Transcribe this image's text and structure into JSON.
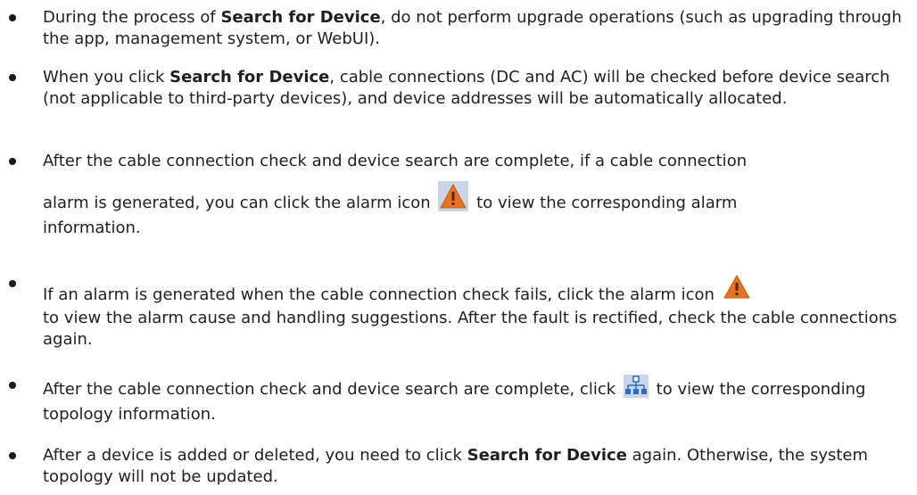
{
  "items": [
    {
      "pre": "During the process of ",
      "bold": "Search for Device",
      "post": ", do not perform upgrade operations (such as upgrading through the app, management system, or WebUI)."
    },
    {
      "pre": "When you click ",
      "bold": "Search for Device",
      "post": ", cable connections (DC and AC) will be checked before device search (not applicable to third-party devices), and device addresses will be automatically allocated."
    },
    {
      "line1": "After the cable connection check and device search are complete, if a cable connection",
      "line2_pre": "alarm is generated, you can click the alarm icon",
      "line2_post": "to view the corresponding alarm",
      "line3": "information."
    },
    {
      "pre": "If an alarm is generated when the cable connection check fails, click the alarm icon",
      "post": "to view the alarm cause and handling suggestions. After the fault is rectified, check the cable connections again."
    },
    {
      "pre": "After the cable connection check and device search are complete, click",
      "post": "to view the corresponding topology information."
    },
    {
      "pre": "After a device is added or deleted, you need to click ",
      "bold": "Search for Device",
      "post": " again. Otherwise, the system topology will not be updated."
    }
  ],
  "icons": {
    "alarm": "alarm-icon",
    "topology": "topology-icon"
  },
  "colors": {
    "alarm_orange": "#e8731a",
    "icon_bg": "#c9d6ea",
    "topology_blue": "#2b6cc4"
  }
}
